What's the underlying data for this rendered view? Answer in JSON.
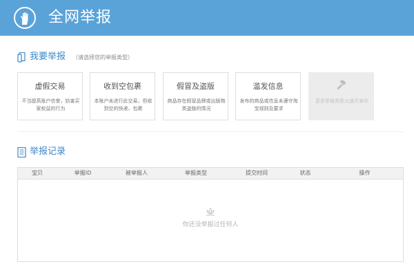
{
  "header": {
    "title": "全网举报",
    "icon": "hand-icon"
  },
  "report_section": {
    "title": "我要举报",
    "hint": "（请选择您的举报类型）",
    "icon": "phone-icon",
    "cards": [
      {
        "title": "虚假交易",
        "desc": "不当提高账户信誉，妨害买家权益的行为"
      },
      {
        "title": "收到空包裹",
        "desc": "本账户未进行此交易，但收到空的快递、包裹"
      },
      {
        "title": "假冒及盗版",
        "desc": "商品存在假冒品牌或出版物类盗版的情况"
      },
      {
        "title": "滥发信息",
        "desc": "发布的商品或信息未遵守淘宝规则及要求"
      },
      {
        "title": "",
        "desc": "更多举报类型火速开发中",
        "icon": "gavel-icon"
      }
    ]
  },
  "records_section": {
    "title": "举报记录",
    "icon": "document-icon",
    "columns": [
      "宝贝",
      "举报ID",
      "被举报人",
      "举报类型",
      "提交时间",
      "状态",
      "操作"
    ],
    "empty_text": "你还没举报过任何人",
    "empty_icon": "lotus-icon"
  },
  "colors": {
    "header_bg": "#5aa3d9",
    "accent": "#3a87c9"
  }
}
